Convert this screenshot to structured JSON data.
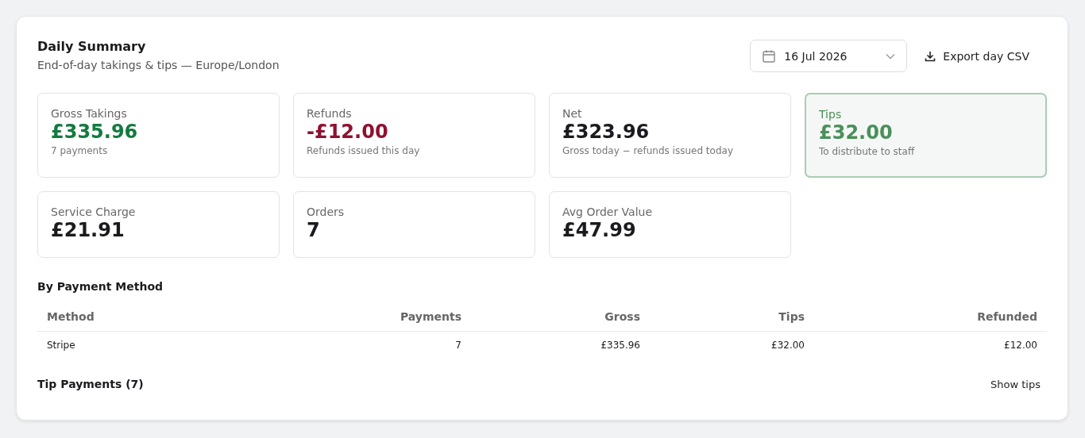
{
  "header": {
    "title": "Daily Summary",
    "subtitle": "End-of-day takings & tips — Europe/London"
  },
  "date_picker": {
    "value": "16 Jul 2026"
  },
  "export_button": {
    "label": "Export day CSV"
  },
  "stats": [
    {
      "label": "Gross Takings",
      "value": "£335.96",
      "note": "7 payments",
      "kind": "positive"
    },
    {
      "label": "Refunds",
      "value": "-£12.00",
      "note": "Refunds issued this day",
      "kind": "negative"
    },
    {
      "label": "Net",
      "value": "£323.96",
      "note": "Gross today − refunds issued today",
      "kind": "neutral"
    },
    {
      "label": "Tips",
      "value": "£32.00",
      "note": "To distribute to staff",
      "kind": "highlight"
    },
    {
      "label": "Service Charge",
      "value": "£21.91",
      "kind": "neutral"
    },
    {
      "label": "Orders",
      "value": "7",
      "kind": "neutral"
    },
    {
      "label": "Avg Order Value",
      "value": "£47.99",
      "kind": "neutral"
    }
  ],
  "payment_methods": {
    "title": "By Payment Method",
    "columns": [
      "Method",
      "Payments",
      "Gross",
      "Tips",
      "Refunded"
    ],
    "rows": [
      [
        "Stripe",
        "7",
        "£335.96",
        "£32.00",
        "£12.00"
      ]
    ]
  },
  "tip_payments": {
    "title": "Tip Payments (7)",
    "toggle": "Show tips"
  }
}
